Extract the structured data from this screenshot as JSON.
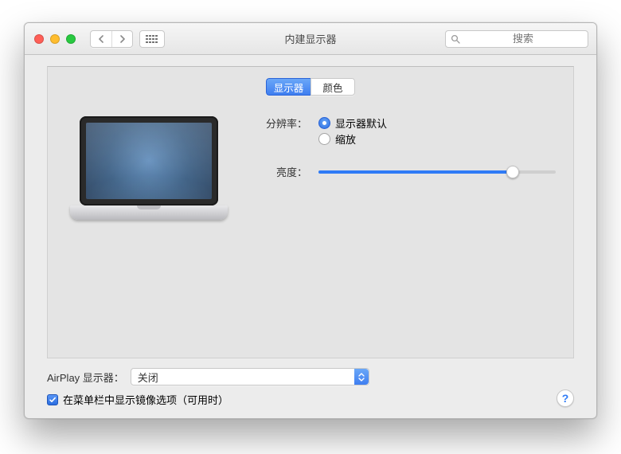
{
  "window": {
    "title": "内建显示器"
  },
  "search": {
    "placeholder": "搜索"
  },
  "tabs": {
    "display": "显示器",
    "color": "颜色",
    "active": "display"
  },
  "resolution": {
    "label": "分辨率：",
    "options": {
      "default": "显示器默认",
      "scaled": "缩放"
    },
    "selected": "default"
  },
  "brightness": {
    "label": "亮度：",
    "percent": 82
  },
  "airplay": {
    "label": "AirPlay 显示器：",
    "value": "关闭"
  },
  "mirroring": {
    "label": "在菜单栏中显示镜像选项（可用时）",
    "checked": true
  },
  "help": {
    "glyph": "?"
  }
}
